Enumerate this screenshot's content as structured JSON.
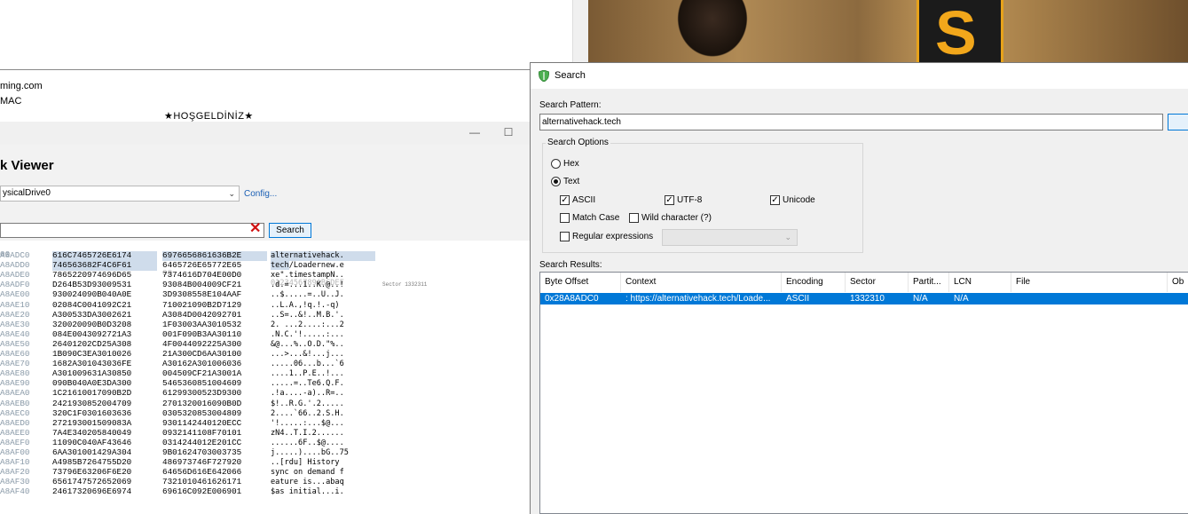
{
  "background_page": {
    "site_line1": "ming.com",
    "site_line2": "MAC",
    "welcome": "★HOŞGELDİNİZ★",
    "banner_logo": "S"
  },
  "disk_viewer": {
    "min_btn": "—",
    "max_btn": "☐",
    "heading": "k Viewer",
    "drive": "ysicalDrive0",
    "config_link": "Config...",
    "search_value": "",
    "clear_icon": "✕",
    "search_button": "Search",
    "header": {
      "offset": "00",
      "hex1": "00",
      "hex2": "08",
      "ascii": "0123456789ABCDEF"
    },
    "rows": [
      {
        "offset": "A8ADC0",
        "hex1": "616C7465726E6174",
        "hex2": "6976656861636B2E",
        "ascii": "alternativehack.",
        "sel1": true,
        "sel2": true,
        "sel3": true
      },
      {
        "offset": "A8ADD0",
        "hex1": "746563682F4C6F61",
        "hex2": "6465726E65772E65",
        "ascii": "tech/Loadernew.e",
        "sel1": true,
        "sel3p": true
      },
      {
        "offset": "A8ADE0",
        "hex1": "7865220974696D65",
        "hex2": "7374616D704E00D0",
        "ascii": "xe\".timestampN.."
      },
      {
        "offset": "A8ADF0",
        "hex1": "D264B53D93009531",
        "hex2": "93084B004009CF21",
        "ascii": ".d.=...1..K.@..!",
        "note": "Sector 1332311"
      },
      {
        "offset": "A8AE00",
        "hex1": "930024090B040A0E",
        "hex2": "3D9308558E104AAF",
        "ascii": "..$.....=..U..J."
      },
      {
        "offset": "A8AE10",
        "hex1": "02084C0041092C21",
        "hex2": "710021090B2D7129",
        "ascii": "..L.A.,!q.!.-q)"
      },
      {
        "offset": "A8AE20",
        "hex1": "A300533DA3002621",
        "hex2": "A3084D0042092701",
        "ascii": "..S=..&!..M.B.'."
      },
      {
        "offset": "A8AE30",
        "hex1": "320020090B0D3208",
        "hex2": "1F03003AA3010532",
        "ascii": "2. ...2....:...2"
      },
      {
        "offset": "A8AE40",
        "hex1": "084E0043092721A3",
        "hex2": "001F090B3AA30110",
        "ascii": ".N.C.'!.....:..."
      },
      {
        "offset": "A8AE50",
        "hex1": "26401202CD25A308",
        "hex2": "4F0044092225A300",
        "ascii": "&@...%..O.D.\"%.."
      },
      {
        "offset": "A8AE60",
        "hex1": "1B090C3EA3010026",
        "hex2": "21A300CD6AA30100",
        "ascii": "...>...&!...j..."
      },
      {
        "offset": "A8AE70",
        "hex1": "1682A301043036FE",
        "hex2": "A30162A301006036",
        "ascii": ".....06...b...`6"
      },
      {
        "offset": "A8AE80",
        "hex1": "A301009631A30850",
        "hex2": "004509CF21A3001A",
        "ascii": "....1..P.E..!..."
      },
      {
        "offset": "A8AE90",
        "hex1": "090B040A0E3DA300",
        "hex2": "5465360851004609",
        "ascii": ".....=..Te6.Q.F."
      },
      {
        "offset": "A8AEA0",
        "hex1": "1C21610017090B2D",
        "hex2": "61299300523D9300",
        "ascii": ".!a....-a)..R=.."
      },
      {
        "offset": "A8AEB0",
        "hex1": "2421930852004709",
        "hex2": "2701320016090B0D",
        "ascii": "$!..R.G.'.2....."
      },
      {
        "offset": "A8AEC0",
        "hex1": "320C1F0301603636",
        "hex2": "0305320853004809",
        "ascii": "2....`66..2.S.H."
      },
      {
        "offset": "A8AED0",
        "hex1": "272193001509083A",
        "hex2": "9301142440120ECC",
        "ascii": "'!.....:...$@..."
      },
      {
        "offset": "A8AEE0",
        "hex1": "7A4E340205840049",
        "hex2": "0932141108F70101",
        "ascii": "zN4..T.I.2......"
      },
      {
        "offset": "A8AEF0",
        "hex1": "11090C040AF43646",
        "hex2": "0314244012E201CC",
        "ascii": "......6F..$@...."
      },
      {
        "offset": "A8AF00",
        "hex1": "6AA301001429A304",
        "hex2": "9B01624703003735",
        "ascii": "j.....)....bG..75"
      },
      {
        "offset": "A8AF10",
        "hex1": "A4985B7264755D20",
        "hex2": "486973746F727920",
        "ascii": "..[rdu] History "
      },
      {
        "offset": "A8AF20",
        "hex1": "73796E63206F6E20",
        "hex2": "64656D616E642066",
        "ascii": "sync on demand f"
      },
      {
        "offset": "A8AF30",
        "hex1": "6561747572652069",
        "hex2": "7321010461626171",
        "ascii": "eature is...abaq"
      },
      {
        "offset": "A8AF40",
        "hex1": "24617320696E6974",
        "hex2": "69616C092E006901",
        "ascii": "$as initial...i."
      }
    ]
  },
  "search_dialog": {
    "title": "Search",
    "pattern_label": "Search Pattern:",
    "pattern_value": "alternativehack.tech",
    "options_label": "Search Options",
    "radio_hex": "Hex",
    "radio_text": "Text",
    "cb_ascii": "ASCII",
    "cb_utf8": "UTF-8",
    "cb_unicode": "Unicode",
    "cb_match_case": "Match Case",
    "cb_wildcard": "Wild character (?)",
    "cb_regex": "Regular expressions",
    "results_label": "Search Results:",
    "columns": {
      "byte_offset": "Byte Offset",
      "context": "Context",
      "encoding": "Encoding",
      "sector": "Sector",
      "partition": "Partit...",
      "lcn": "LCN",
      "file": "File",
      "extra": "Ob"
    },
    "result": {
      "byte_offset": "0x28A8ADC0",
      "context": ": https://alternativehack.tech/Loade...",
      "encoding": "ASCII",
      "sector": "1332310",
      "partition": "N/A",
      "lcn": "N/A"
    }
  },
  "colors": {
    "accent": "#0078d7",
    "selection": "#cfdceb",
    "clear_icon": "#d01010",
    "logo": "#f2a71b"
  }
}
